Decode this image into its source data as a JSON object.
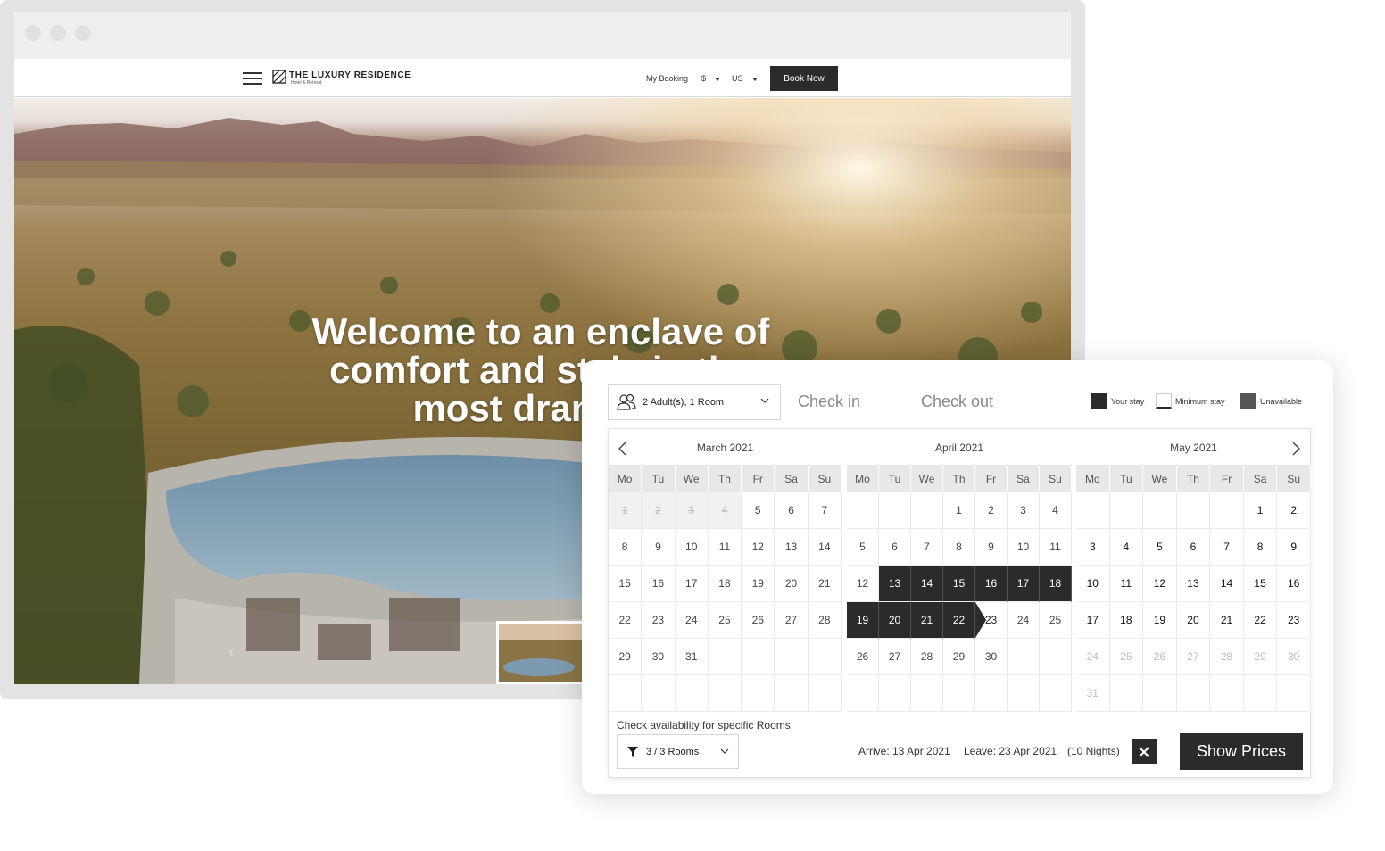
{
  "site": {
    "brand": "THE LUXURY RESIDENCE",
    "brand_sub": "Hotel & Retreat",
    "nav": {
      "my_booking": "My Booking",
      "currency": "$",
      "locale": "US",
      "book_now": "Book Now"
    },
    "hero": {
      "title_lines": [
        "Welcome to an enclave of",
        "comfort and style in the",
        "most dramatic"
      ]
    }
  },
  "booking": {
    "guests": "2 Adult(s), 1 Room",
    "check_in_placeholder": "Check in",
    "check_out_placeholder": "Check out",
    "legend": {
      "your_stay": "Your stay",
      "minimum_stay": "Minimum stay",
      "unavailable": "Unavailable"
    },
    "weekdays": [
      "Mo",
      "Tu",
      "We",
      "Th",
      "Fr",
      "Sa",
      "Su"
    ],
    "months": [
      {
        "title": "March 2021",
        "offset": 0,
        "days": 31,
        "past_until": 4,
        "dim_from": 32,
        "stay": [],
        "checkout": 0
      },
      {
        "title": "April 2021",
        "offset": 3,
        "days": 30,
        "past_until": 0,
        "dim_from": 31,
        "stay": [
          13,
          14,
          15,
          16,
          17,
          18,
          19,
          20,
          21,
          22
        ],
        "checkout": 23
      },
      {
        "title": "May 2021",
        "offset": 5,
        "days": 31,
        "past_until": 0,
        "dim_from": 24,
        "stay": [],
        "checkout": 0
      }
    ],
    "specific_rooms_label": "Check availability for specific Rooms:",
    "rooms_filter": "3 / 3 Rooms",
    "arrive": "Arrive: 13 Apr 2021",
    "leave": "Leave: 23 Apr 2021",
    "nights": "(10 Nights)",
    "clear_icon": "close-icon",
    "show_prices": "Show Prices"
  },
  "colors": {
    "primary_dark": "#2b2b2b",
    "unavailable": "#555555",
    "weekday_header_bg": "#e8e8e8"
  }
}
